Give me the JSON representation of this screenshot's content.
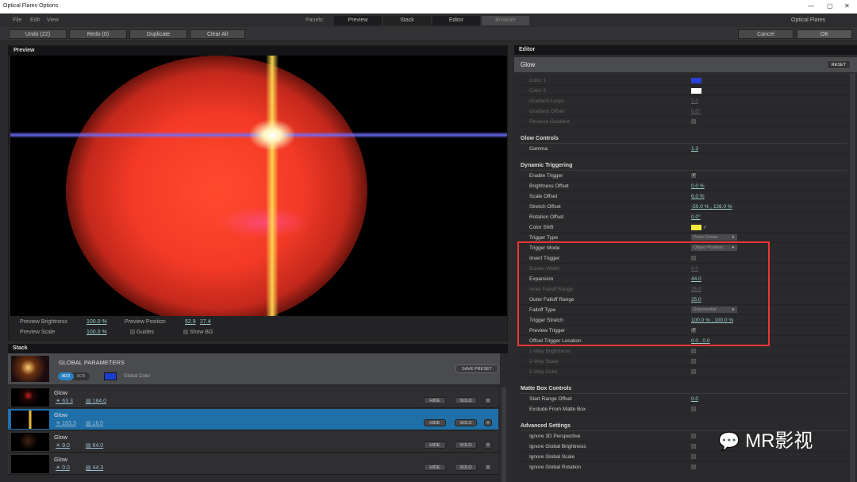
{
  "window": {
    "title": "Optical Flares Options",
    "brand": "Optical Flares",
    "min": "—",
    "max": "▢",
    "close": "✕"
  },
  "menu": [
    "File",
    "Edit",
    "View"
  ],
  "panels_label": "Panels:",
  "panel_tabs": [
    "Preview",
    "Stack",
    "Editor",
    "Browser"
  ],
  "toolbar": {
    "undo": "Undo (22)",
    "redo": "Redo (0)",
    "duplicate": "Duplicate",
    "clear": "Clear All",
    "cancel": "Cancel",
    "ok": "OK"
  },
  "preview": {
    "title": "Preview",
    "brightness_label": "Preview Brightness",
    "brightness": "100.0 %",
    "scale_label": "Preview Scale",
    "scale": "100.0 %",
    "position_label": "Preview Position",
    "pos_x": "52.9",
    "pos_y": "27.4",
    "guides": "Guides",
    "show_bg": "Show BG"
  },
  "stack": {
    "title": "Stack",
    "global": "GLOBAL PARAMETERS",
    "add": "ADD",
    "scn": "SCN",
    "global_color": "Global Color",
    "global_color_hex": "#1a3fd0",
    "save_preset": "SAVE PRESET",
    "hide": "HIDE",
    "solo": "SOLO",
    "x": "X",
    "layers": [
      {
        "name": "Glow",
        "a": "63.3",
        "b": "184.0",
        "selected": false
      },
      {
        "name": "Glow",
        "a": "163.3",
        "b": "16.0",
        "selected": true
      },
      {
        "name": "Glow",
        "a": "9.0",
        "b": "84.0",
        "selected": false
      },
      {
        "name": "Glow",
        "a": "0.0",
        "b": "44.3",
        "selected": false
      }
    ]
  },
  "editor": {
    "title": "Editor",
    "layer": "Glow",
    "reset": "RESET",
    "rows": [
      {
        "label": "Color 1",
        "type": "swatch",
        "color": "#2a3fd8",
        "dim": true
      },
      {
        "label": "Color 2",
        "type": "swatch",
        "color": "#ffffff",
        "dim": true
      },
      {
        "label": "Gradient Loops",
        "value": "1.0",
        "dim": true
      },
      {
        "label": "Gradient Offset",
        "value": "0.0°",
        "dim": true
      },
      {
        "label": "Reverse Gradient",
        "type": "check",
        "dim": true
      },
      {
        "header": "Glow Controls"
      },
      {
        "label": "Gamma",
        "value": "1.3"
      },
      {
        "header": "Dynamic Triggering"
      },
      {
        "label": "Enable Trigger",
        "type": "check",
        "checked": true
      },
      {
        "label": "Brightness Offset",
        "value": "0.0 %"
      },
      {
        "label": "Scale Offset",
        "value": "6.0 %"
      },
      {
        "label": "Stretch Offset",
        "value": "-50.0 % , 126.0 %"
      },
      {
        "label": "Rotation Offset",
        "value": "0.0°"
      },
      {
        "label": "Color Shift",
        "type": "swatch",
        "color": "#f2ee3a",
        "checked": true
      },
      {
        "label": "Trigger Type",
        "type": "dropdown",
        "value": "From Center"
      },
      {
        "label": "Trigger Mode",
        "type": "dropdown",
        "value": "Object Position"
      },
      {
        "label": "Invert Trigger",
        "type": "check"
      },
      {
        "label": "Border Width",
        "value": "0.0",
        "dim": true
      },
      {
        "label": "Expansion",
        "value": "44.0"
      },
      {
        "label": "Inner Falloff Range",
        "value": "25.0",
        "dim": true
      },
      {
        "label": "Outer Falloff Range",
        "value": "25.0"
      },
      {
        "label": "Falloff Type",
        "type": "dropdown",
        "value": "Exponential"
      },
      {
        "label": "Trigger Stretch",
        "value": "100.0 % , 100.0 %"
      },
      {
        "label": "Preview Trigger",
        "type": "check",
        "checked": true
      },
      {
        "label": "Offset Trigger Location",
        "value": "0.0 , 0.0"
      },
      {
        "label": "1-Way Brightness",
        "type": "check",
        "dim": true
      },
      {
        "label": "1-Way Scale",
        "type": "check",
        "dim": true
      },
      {
        "label": "1-Way Color",
        "type": "check",
        "dim": true
      },
      {
        "header": "Matte Box Controls"
      },
      {
        "label": "Start Range Offset",
        "value": "0.0"
      },
      {
        "label": "Exclude From Matte Box",
        "type": "check"
      },
      {
        "header": "Advanced Settings"
      },
      {
        "label": "Ignore 3D Perspective",
        "type": "check"
      },
      {
        "label": "Ignore Global Brightness",
        "type": "check"
      },
      {
        "label": "Ignore Global Scale",
        "type": "check"
      },
      {
        "label": "Ignore Global Rotation",
        "type": "check"
      }
    ]
  },
  "watermark": "MR影视"
}
